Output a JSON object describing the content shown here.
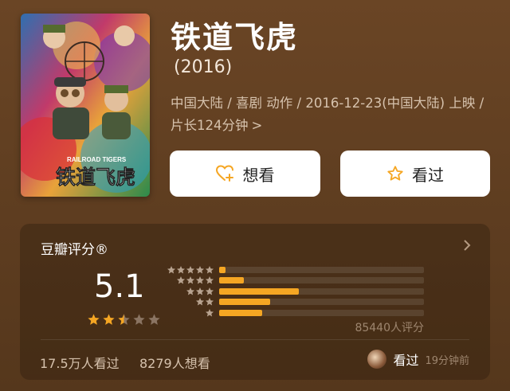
{
  "movie": {
    "title": "铁道飞虎",
    "year": "(2016)",
    "meta": "中国大陆 / 喜剧 动作 / 2016-12-23(中国大陆) 上映 / 片长124分钟",
    "meta_chevron": ">",
    "poster_text_cn": "铁道飞虎",
    "poster_text_en": "RAILROAD TIGERS"
  },
  "actions": {
    "want_label": "想看",
    "seen_label": "看过"
  },
  "rating": {
    "header": "豆瓣评分®",
    "score": "5.1",
    "stars_filled": 2.5,
    "star_color": "#f5a623",
    "distribution": [
      {
        "stars": 5,
        "fraction": 0.03
      },
      {
        "stars": 4,
        "fraction": 0.12
      },
      {
        "stars": 3,
        "fraction": 0.39
      },
      {
        "stars": 2,
        "fraction": 0.25
      },
      {
        "stars": 1,
        "fraction": 0.21
      }
    ],
    "count": "85440人评分"
  },
  "footer": {
    "seen": "17.5万人看过",
    "want": "8279人想看",
    "friend_action": "看过",
    "friend_time": "19分钟前"
  }
}
